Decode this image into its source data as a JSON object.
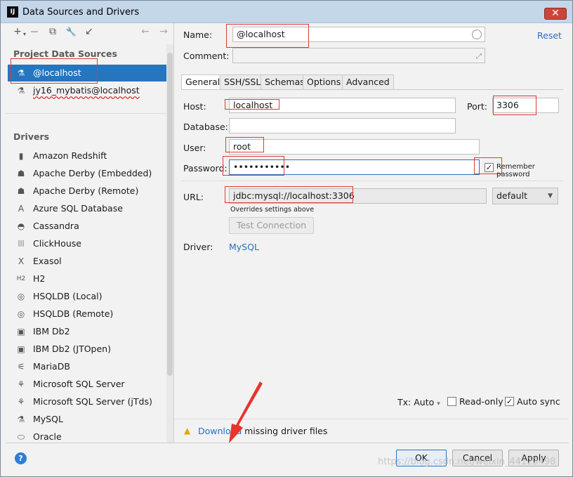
{
  "window": {
    "title": "Data Sources and Drivers",
    "close_glyph": "✕",
    "app_icon_text": "IJ"
  },
  "toolbar": {
    "add": "+",
    "add_caret": "▾",
    "remove": "—",
    "copy": "⧉",
    "settings": "🔧",
    "import": "↙",
    "back": "←",
    "forward": "→"
  },
  "project": {
    "title": "Project Data Sources",
    "items": [
      {
        "label": "@localhost",
        "selected": true
      },
      {
        "label": "jy16_mybatis@localhost",
        "selected": false
      }
    ]
  },
  "drivers": {
    "title": "Drivers",
    "items": [
      {
        "label": "Amazon Redshift",
        "icon": "redshift-icon",
        "glyph": "▮"
      },
      {
        "label": "Apache Derby (Embedded)",
        "icon": "derby-icon",
        "glyph": "☗"
      },
      {
        "label": "Apache Derby (Remote)",
        "icon": "derby-icon",
        "glyph": "☗"
      },
      {
        "label": "Azure SQL Database",
        "icon": "azure-icon",
        "glyph": "A"
      },
      {
        "label": "Cassandra",
        "icon": "cassandra-icon",
        "glyph": "◓"
      },
      {
        "label": "ClickHouse",
        "icon": "clickhouse-icon",
        "glyph": "|||"
      },
      {
        "label": "Exasol",
        "icon": "exasol-icon",
        "glyph": "X"
      },
      {
        "label": "H2",
        "icon": "h2-icon",
        "glyph": "H2"
      },
      {
        "label": "HSQLDB (Local)",
        "icon": "hsqldb-icon",
        "glyph": "◎"
      },
      {
        "label": "HSQLDB (Remote)",
        "icon": "hsqldb-icon",
        "glyph": "◎"
      },
      {
        "label": "IBM Db2",
        "icon": "db2-icon",
        "glyph": "▣"
      },
      {
        "label": "IBM Db2 (JTOpen)",
        "icon": "db2-icon",
        "glyph": "▣"
      },
      {
        "label": "MariaDB",
        "icon": "mariadb-icon",
        "glyph": "⚟"
      },
      {
        "label": "Microsoft SQL Server",
        "icon": "mssql-icon",
        "glyph": "⚘"
      },
      {
        "label": "Microsoft SQL Server (jTds)",
        "icon": "mssql-icon",
        "glyph": "⚘"
      },
      {
        "label": "MySQL",
        "icon": "mysql-icon",
        "glyph": "⚗"
      },
      {
        "label": "Oracle",
        "icon": "oracle-icon",
        "glyph": "⬭"
      }
    ]
  },
  "form": {
    "name_label": "Name:",
    "name_value": "@localhost",
    "comment_label": "Comment:",
    "comment_value": "",
    "reset_label": "Reset",
    "tabs": [
      "General",
      "SSH/SSL",
      "Schemas",
      "Options",
      "Advanced"
    ],
    "host_label": "Host:",
    "host_value": "localhost",
    "port_label": "Port:",
    "port_value": "3306",
    "database_label": "Database:",
    "database_value": "",
    "user_label": "User:",
    "user_value": "root",
    "password_label": "Password:",
    "password_value": "•••••••••••",
    "remember_label": "Remember password",
    "remember_checked": "✓",
    "url_label": "URL:",
    "url_value": "jdbc:mysql://localhost:3306",
    "url_mode": "default",
    "overrides_note": "Overrides settings above",
    "test_connection": "Test Connection",
    "driver_label": "Driver:",
    "driver_value": "MySQL"
  },
  "footer": {
    "tx_label": "Tx: Auto",
    "tx_caret": "▾",
    "readonly_label": "Read-only",
    "autosync_label": "Auto sync",
    "autosync_checked": "✓",
    "warning_glyph": "▲",
    "download_link": "Download",
    "download_text": " missing driver files"
  },
  "buttons": {
    "help": "?",
    "ok": "OK",
    "cancel": "Cancel",
    "apply": "Apply"
  },
  "watermark": "https://blog.csdn.net/weixin_44123498"
}
